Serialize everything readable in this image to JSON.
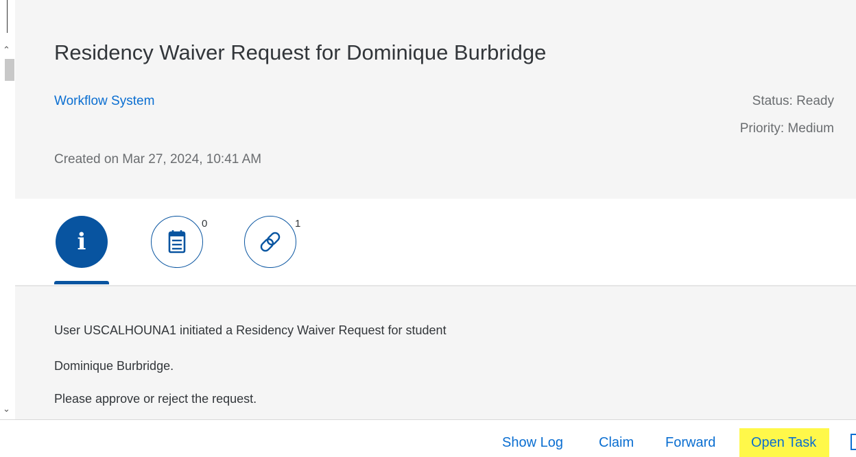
{
  "header": {
    "title": "Residency Waiver Request for Dominique Burbridge",
    "system_link": "Workflow System",
    "status": "Status: Ready",
    "priority": "Priority: Medium",
    "created": "Created on Mar 27, 2024, 10:41 AM"
  },
  "tabs": [
    {
      "name": "info",
      "icon": "info-icon",
      "count": "",
      "selected": true
    },
    {
      "name": "notes",
      "icon": "notes-icon",
      "count": "0",
      "selected": false
    },
    {
      "name": "attachments",
      "icon": "link-icon",
      "count": "1",
      "selected": false
    }
  ],
  "description": {
    "line1": "User USCALHOUNA1 initiated a Residency Waiver Request for student",
    "line2": "Dominique Burbridge.",
    "line3": "Please approve or reject the request."
  },
  "footer": {
    "show_log": "Show Log",
    "claim": "Claim",
    "forward": "Forward",
    "open_task": "Open Task"
  },
  "colors": {
    "accent": "#0854a0",
    "link": "#0a6ed1",
    "highlight": "#fff84a",
    "header_bg": "#f5f5f5"
  }
}
